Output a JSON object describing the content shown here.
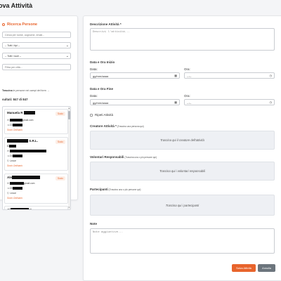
{
  "page": {
    "title": "ova Attività"
  },
  "search_panel": {
    "title": "Ricerca Persone",
    "search_placeholder": "Cerca per nome, cognome, email...",
    "type_select": "-- Tutti i tipi --",
    "role_select": "-- Tutti i ruoli --",
    "city_placeholder": "Filtra per città...",
    "drag_hint_bold": "Trascina",
    "drag_hint_rest": " le persone nei campi del form →",
    "results_count": "sultati: 847 di 847"
  },
  "results": [
    {
      "name": "Manuela R",
      "badge": "Socio",
      "email": "gmail.com",
      "phone": "33",
      "group": "Socio Ordinario"
    },
    {
      "name": "S.R.L.",
      "name_line2": "C",
      "badge": "Socio",
      "email": "",
      "phone": "34",
      "city": "Lecce",
      "group": "Socio Ordinario"
    },
    {
      "name": "Ale",
      "badge": "Socio",
      "email": "gmail.com",
      "phone": "39",
      "city": "Lecce",
      "group": "Socio Ordinario"
    },
    {
      "name": "Al",
      "name_suffix": "ot"
    }
  ],
  "form": {
    "description_label": "Descrizione Attività *",
    "description_placeholder": "Descrivi l'attività...",
    "start_section": "Data e Ora Inizio",
    "start_date_label": "Data:",
    "start_date_placeholder": "gg/mm/aaaa",
    "start_time_label": "Ora:",
    "start_time_placeholder": "--:--",
    "end_section": "Data e Ora Fine",
    "end_date_label": "Data:",
    "end_date_placeholder": "gg/mm/aaaa",
    "end_time_label": "Ora:",
    "end_time_placeholder": "--:--",
    "repeat_label": "Ripeti Attività",
    "creator_label": "Creatore Attività *",
    "creator_hint": " (Trascina una persona qui)",
    "creator_drop": "Trascina qui il creatore dell'attività",
    "managers_label": "Volontari Responsabili",
    "managers_hint": " (Trascina una o più persone qui)",
    "managers_drop": "Trascina qui i volontari responsabili",
    "participants_label": "Partecipanti",
    "participants_hint": " (Trascina una o più persone qui)",
    "participants_drop": "Trascina qui i partecipanti",
    "notes_label": "Note",
    "notes_placeholder": "Note aggiuntive...",
    "save_label": "Salva Attività",
    "cancel_label": "Annulla"
  },
  "colors": {
    "accent": "#e8642c",
    "secondary": "#6c757d",
    "dropzone": "#eef0f4"
  },
  "icons": [
    "search-icon",
    "email-icon",
    "phone-icon",
    "location-icon",
    "calendar-icon",
    "clock-icon",
    "chevron-down-icon"
  ]
}
